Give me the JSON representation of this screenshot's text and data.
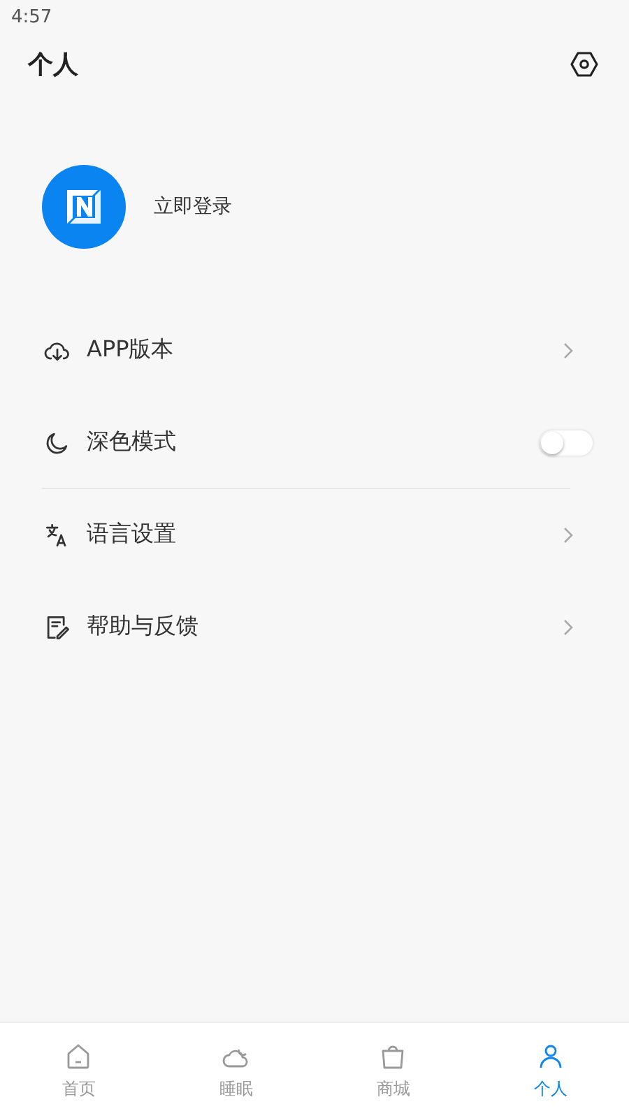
{
  "status_bar": {
    "time": "4:57"
  },
  "header": {
    "title": "个人"
  },
  "profile": {
    "login_label": "立即登录"
  },
  "menu": [
    {
      "kind": "link",
      "label": "APP版本",
      "divider": false
    },
    {
      "kind": "toggle",
      "label": "深色模式",
      "on": false,
      "divider": true
    },
    {
      "kind": "link",
      "label": "语言设置",
      "divider": false
    },
    {
      "kind": "link",
      "label": "帮助与反馈",
      "divider": false
    }
  ],
  "tabs": [
    {
      "label": "首页",
      "selected": false
    },
    {
      "label": "睡眠",
      "selected": false
    },
    {
      "label": "商城",
      "selected": false
    },
    {
      "label": "个人",
      "selected": true
    }
  ]
}
